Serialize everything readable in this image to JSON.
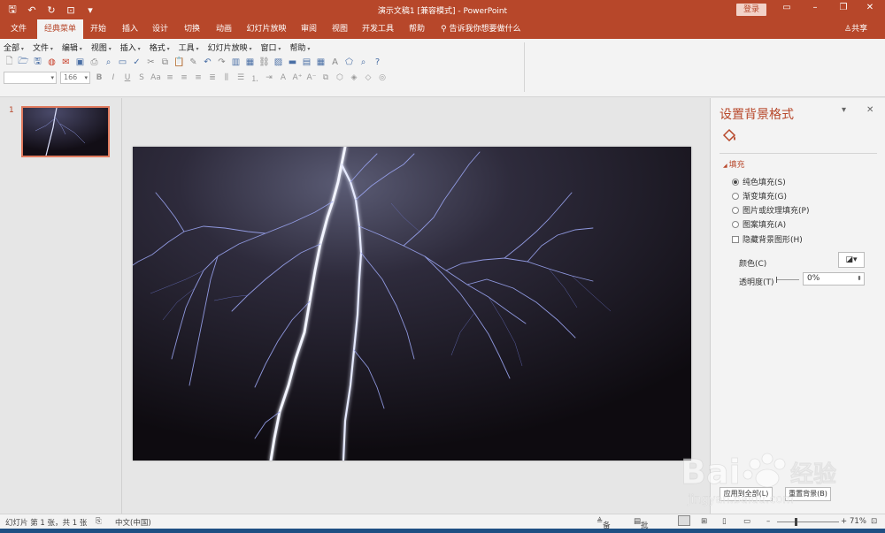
{
  "titlebar": {
    "doc_title": "演示文稿1 [兼容模式]  -  PowerPoint",
    "login": "登录",
    "bg": "#b7472a"
  },
  "tabs": [
    {
      "label": "文件"
    },
    {
      "label": "经典菜单"
    },
    {
      "label": "开始"
    },
    {
      "label": "插入"
    },
    {
      "label": "设计"
    },
    {
      "label": "切换"
    },
    {
      "label": "动画"
    },
    {
      "label": "幻灯片放映"
    },
    {
      "label": "审阅"
    },
    {
      "label": "视图"
    },
    {
      "label": "开发工具"
    },
    {
      "label": "帮助"
    }
  ],
  "tellme": "告诉我你想要做什么",
  "share": "共享",
  "classic_menu": [
    "全部",
    "文件",
    "编辑",
    "视图",
    "插入",
    "格式",
    "工具",
    "幻灯片放映",
    "窗口",
    "帮助"
  ],
  "font_size": "166",
  "thumbnail": {
    "number": "1"
  },
  "format_pane": {
    "title": "设置背景格式",
    "fill_header": "填充",
    "options": [
      {
        "label": "纯色填充(S)",
        "checked": true
      },
      {
        "label": "渐变填充(G)",
        "checked": false
      },
      {
        "label": "图片或纹理填充(P)",
        "checked": false
      },
      {
        "label": "图案填充(A)",
        "checked": false
      }
    ],
    "hide_bg": "隐藏背景图形(H)",
    "color_label": "颜色(C)",
    "transparency_label": "透明度(T)",
    "transparency_value": "0%",
    "apply_all": "应用到全部(L)",
    "reset": "重置背景(B)"
  },
  "statusbar": {
    "slide_info": "幻灯片 第 1 张，共 1 张",
    "language": "中文(中国)",
    "notes": "备注",
    "comments": "批注",
    "zoom": "71%"
  },
  "watermark": {
    "brand": "Bai",
    "brand2": "经验",
    "url": "jingyan.baidu.com"
  }
}
